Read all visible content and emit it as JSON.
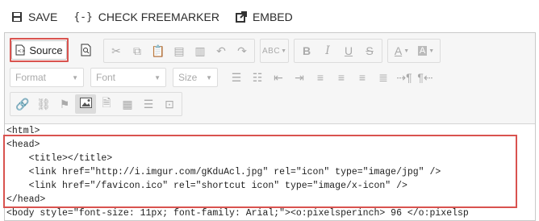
{
  "topbar": {
    "save_label": "SAVE",
    "check_label": "CHECK FREEMARKER",
    "embed_label": "EMBED"
  },
  "toolbar": {
    "source_label": "Source",
    "format_label": "Format",
    "font_label": "Font",
    "size_label": "Size",
    "spellcheck_label": "ABC"
  },
  "code": {
    "lines": [
      "<html>",
      "<head>",
      "    <title></title>",
      "    <link href=\"http://i.imgur.com/gKduAcl.jpg\" rel=\"icon\" type=\"image/jpg\" />",
      "    <link href=\"/favicon.ico\" rel=\"shortcut icon\" type=\"image/x-icon\" />",
      "</head>",
      "<body style=\"font-size: 11px; font-family: Arial;\"><o:pixelsperinch> 96 </o:pixelsp"
    ]
  },
  "colors": {
    "highlight": "#d9534f",
    "toolbar_bg": "#f6f6f6"
  }
}
